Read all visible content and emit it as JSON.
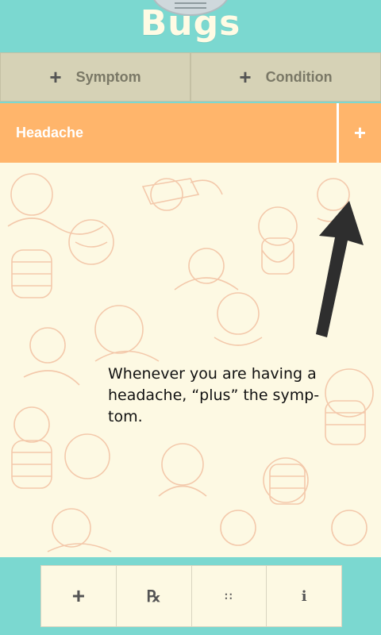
{
  "app": {
    "title": "Bugs"
  },
  "add_bar": {
    "symptom": {
      "icon": "+",
      "label": "Symptom"
    },
    "condition": {
      "icon": "+",
      "label": "Condition"
    }
  },
  "symptoms": [
    {
      "name": "Headache",
      "add_icon": "+"
    }
  ],
  "hint": {
    "text": "Whenever you are having a headache, “plus” the symp-tom."
  },
  "bottom_nav": [
    {
      "name": "add-icon",
      "glyph": "+"
    },
    {
      "name": "prescription-icon",
      "glyph": "℞"
    },
    {
      "name": "grid-icon",
      "glyph": "∷"
    },
    {
      "name": "info-icon",
      "glyph": "i"
    }
  ],
  "colors": {
    "teal": "#7bd8d0",
    "orange": "#ffb56b",
    "cream": "#fdf9e3",
    "tan": "#d6d2b6"
  }
}
